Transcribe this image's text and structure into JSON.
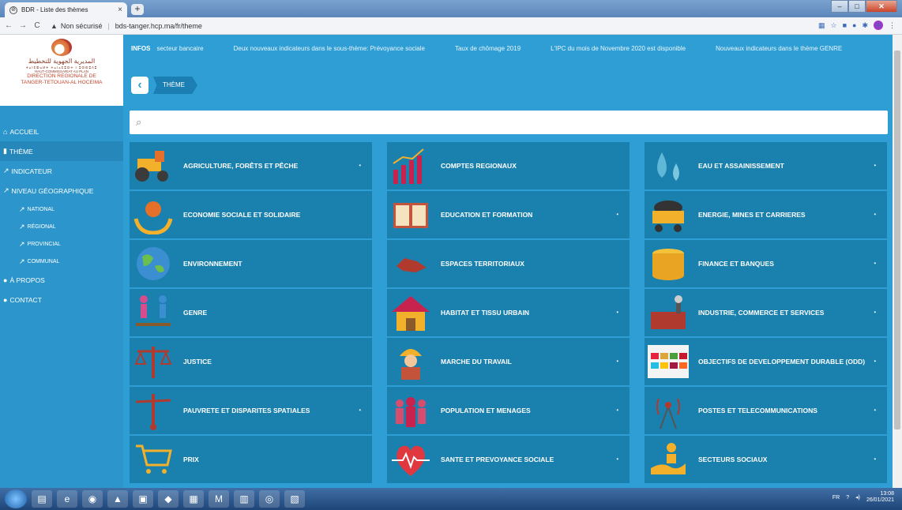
{
  "browser": {
    "tab_title": "BDR - Liste des thèmes",
    "tab_close": "×",
    "new_tab": "+",
    "security": "Non sécurisé",
    "url": "bds-tanger.hcp.ma/fr/theme",
    "profile_initial": "N"
  },
  "logo": {
    "arabic": "المديرية الجهوية للتخطيط",
    "tifinagh": "ⵜⴰⵏⵎⵀⴰⵍⵜ ⵜⴰⵏⴰⵎⵓⵔⵜ ⵏ ⵓⵙⵙⵓⴷⵓ",
    "hcp": "HAUT-COMMISSARIAT AU PLAN",
    "direction_1": "DIRECTION REGIONALE DE",
    "direction_2": "TANGER-TETOUAN-AL HOCEIMA"
  },
  "sidebar": {
    "items": [
      {
        "label": "ACCUEIL"
      },
      {
        "label": "THÈME"
      },
      {
        "label": "INDICATEUR"
      },
      {
        "label": "NIVEAU GÉOGRAPHIQUE"
      },
      {
        "label": "NATIONAL"
      },
      {
        "label": "RÉGIONAL"
      },
      {
        "label": "PROVINCIAL"
      },
      {
        "label": "COMMUNAL"
      },
      {
        "label": "À PROPOS"
      },
      {
        "label": "CONTACT"
      }
    ]
  },
  "news": {
    "tag": "INFOS",
    "items": [
      "secteur bancaire",
      "Deux nouveaux indicateurs dans le sous-thème: Prévoyance sociale",
      "Taux de chômage 2019",
      "L'IPC du mois de Novembre 2020 est disponible",
      "Nouveaux indicateurs dans le thème GENRE"
    ]
  },
  "breadcrumb": {
    "back": "‹",
    "current": "THÈME"
  },
  "search": {
    "placeholder": ""
  },
  "themes": [
    {
      "label": "AGRICULTURE, FORÊTS ET PÊCHE",
      "chevron": "▪"
    },
    {
      "label": "COMPTES REGIONAUX",
      "chevron": ""
    },
    {
      "label": "EAU ET ASSAINISSEMENT",
      "chevron": "▪"
    },
    {
      "label": "ECONOMIE SOCIALE ET SOLIDAIRE",
      "chevron": ""
    },
    {
      "label": "EDUCATION ET FORMATION",
      "chevron": "▪"
    },
    {
      "label": "ENERGIE, MINES ET CARRIERES",
      "chevron": "▪"
    },
    {
      "label": "ENVIRONNEMENT",
      "chevron": ""
    },
    {
      "label": "ESPACES TERRITORIAUX",
      "chevron": ""
    },
    {
      "label": "FINANCE ET BANQUES",
      "chevron": "▪"
    },
    {
      "label": "GENRE",
      "chevron": ""
    },
    {
      "label": "HABITAT ET TISSU URBAIN",
      "chevron": "▪"
    },
    {
      "label": "INDUSTRIE, COMMERCE ET SERVICES",
      "chevron": "▪"
    },
    {
      "label": "JUSTICE",
      "chevron": ""
    },
    {
      "label": "MARCHE DU TRAVAIL",
      "chevron": "▪"
    },
    {
      "label": "OBJECTIFS DE DEVELOPPEMENT DURABLE (ODD)",
      "chevron": "▪"
    },
    {
      "label": "PAUVRETE ET DISPARITES SPATIALES",
      "chevron": "▪"
    },
    {
      "label": "POPULATION ET MENAGES",
      "chevron": "▪"
    },
    {
      "label": "POSTES ET TELECOMMUNICATIONS",
      "chevron": "▪"
    },
    {
      "label": "PRIX",
      "chevron": ""
    },
    {
      "label": "SANTE ET PREVOYANCE SOCIALE",
      "chevron": "▪"
    },
    {
      "label": "SECTEURS SOCIAUX",
      "chevron": "▪"
    }
  ],
  "taskbar": {
    "lang": "FR",
    "time": "13:08",
    "date": "26/01/2021"
  }
}
